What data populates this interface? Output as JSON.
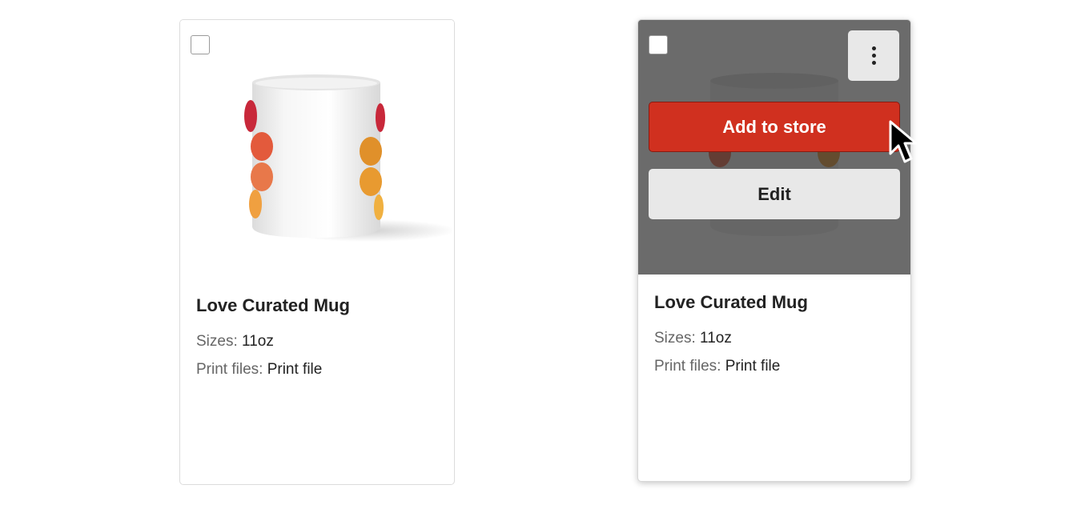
{
  "cards": [
    {
      "title": "Love Curated Mug",
      "sizes_label": "Sizes:",
      "sizes_value": "11oz",
      "print_files_label": "Print files:",
      "print_files_value": "Print file",
      "hovered": false
    },
    {
      "title": "Love Curated Mug",
      "sizes_label": "Sizes:",
      "sizes_value": "11oz",
      "print_files_label": "Print files:",
      "print_files_value": "Print file",
      "hovered": true,
      "add_to_store_label": "Add to store",
      "edit_label": "Edit",
      "more_icon": "vertical-ellipsis-icon"
    }
  ],
  "colors": {
    "add_to_store": "#d0301f",
    "edit": "#e8e8e8",
    "overlay": "#4a4a4a",
    "petal_red": "#d94a3a",
    "petal_orange": "#e98a3a"
  },
  "cursor_icon": "mouse-pointer-icon"
}
